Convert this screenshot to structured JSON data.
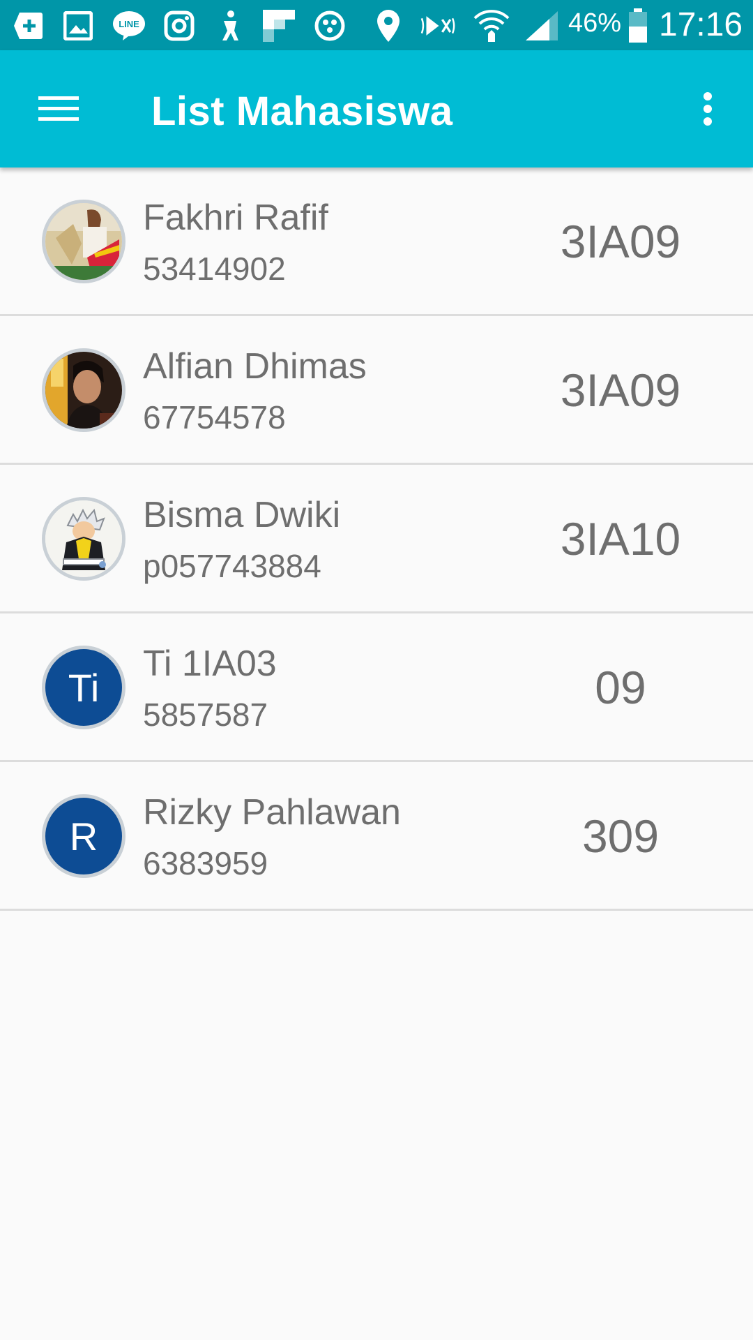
{
  "status_bar": {
    "icons": [
      "add-app-icon",
      "image-icon",
      "line-app-icon",
      "instagram-icon",
      "accessibility-icon",
      "flipboard-icon",
      "ball-icon",
      "location-icon",
      "nfc-mute-icon",
      "wifi-icon",
      "signal-icon",
      "battery-icon"
    ],
    "battery_percent": "46%",
    "time": "17:16",
    "background_color": "#0096a8"
  },
  "app_bar": {
    "title": "List Mahasiswa",
    "menu_icon": "hamburger-menu-icon",
    "overflow_icon": "more-vert-icon",
    "background_color": "#00bcd4"
  },
  "students": [
    {
      "name": "Fakhri Rafif",
      "npm": "53414902",
      "class": "3IA09",
      "avatar": "photo"
    },
    {
      "name": "Alfian Dhimas",
      "npm": "67754578",
      "class": "3IA09",
      "avatar": "photo"
    },
    {
      "name": "Bisma Dwiki",
      "npm": "p057743884",
      "class": "3IA10",
      "avatar": "photo"
    },
    {
      "name": "Ti 1IA03",
      "npm": "5857587",
      "class": "09",
      "avatar_letter": "Ti"
    },
    {
      "name": "Rizky Pahlawan",
      "npm": "6383959",
      "class": "309",
      "avatar_letter": "R"
    }
  ],
  "colors": {
    "avatar_letter_bg": "#0d4c94",
    "text": "#6e6e6e",
    "divider": "#dcdcdc"
  }
}
